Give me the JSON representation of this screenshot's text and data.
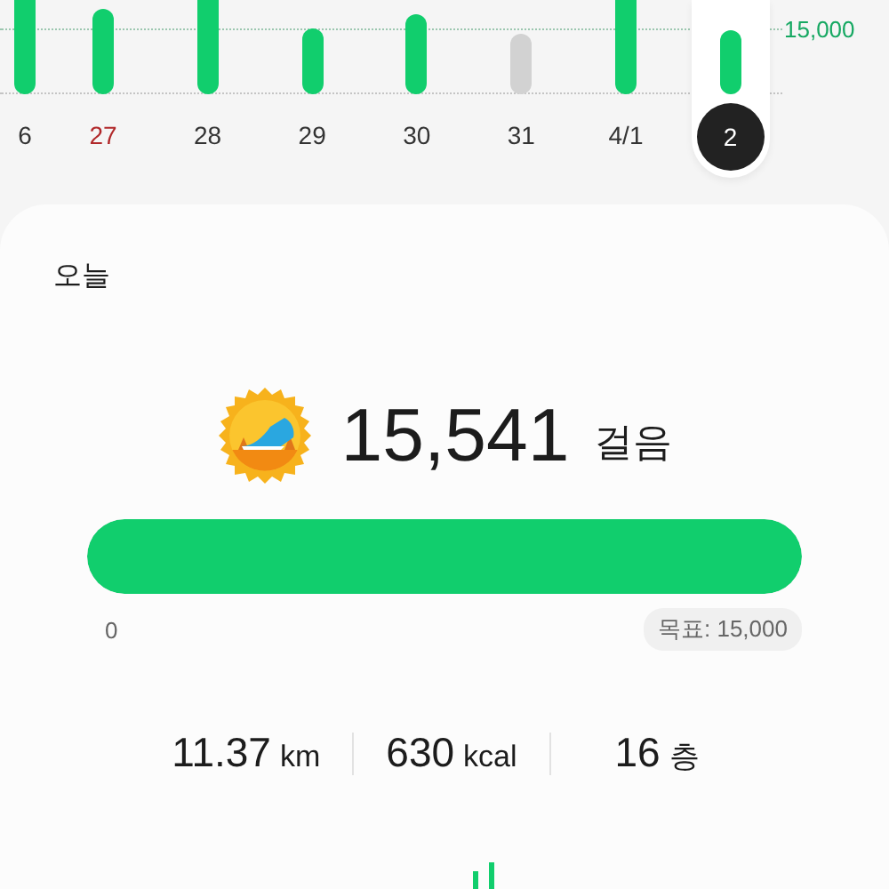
{
  "week_chart": {
    "goal_label": "15,000",
    "days": [
      {
        "label": "6",
        "holiday": false,
        "selected": false,
        "color": "#11ce6d"
      },
      {
        "label": "27",
        "holiday": true,
        "selected": false,
        "color": "#11ce6d"
      },
      {
        "label": "28",
        "holiday": false,
        "selected": false,
        "color": "#11ce6d"
      },
      {
        "label": "29",
        "holiday": false,
        "selected": false,
        "color": "#11ce6d"
      },
      {
        "label": "30",
        "holiday": false,
        "selected": false,
        "color": "#11ce6d"
      },
      {
        "label": "31",
        "holiday": false,
        "selected": false,
        "color": "#d2d2d2"
      },
      {
        "label": "4/1",
        "holiday": false,
        "selected": false,
        "color": "#11ce6d"
      },
      {
        "label": "2",
        "holiday": false,
        "selected": true,
        "color": "#11ce6d"
      }
    ]
  },
  "today": {
    "title": "오늘",
    "steps": "15,541",
    "steps_unit": "걸음",
    "level": 1,
    "min_label": "0",
    "goal": "목표: 15,000",
    "stats": [
      {
        "value": "11.37",
        "unit": "km"
      },
      {
        "value": "630",
        "unit": "kcal"
      },
      {
        "value": "16",
        "unit": "층"
      }
    ]
  }
}
